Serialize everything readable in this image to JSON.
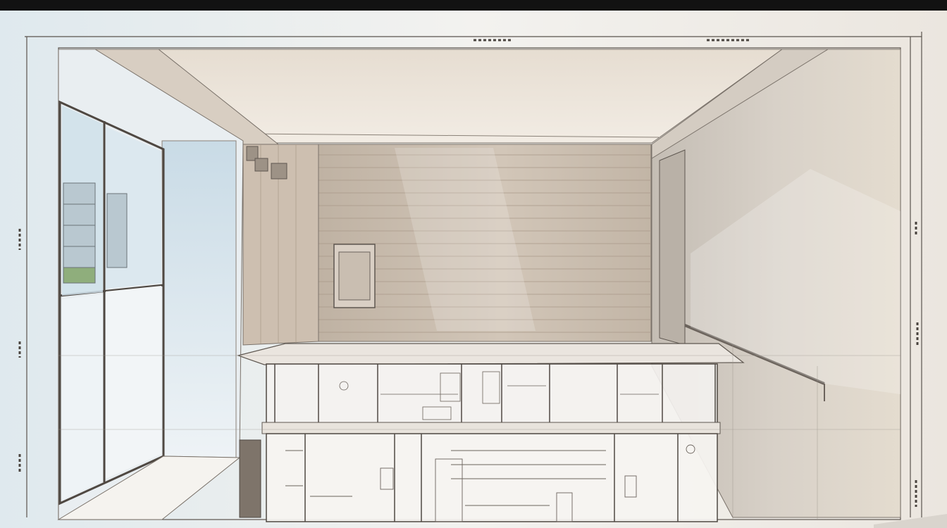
{
  "illustration": {
    "subject": "interior-perspective-sketch-with-window-and-plank-wall",
    "palette": {
      "frame_bar": "#121212",
      "paper": "#eef0f0",
      "ceiling": "#ece4da",
      "plank_wall": "#c9bcad",
      "right_wall": "#cfc7bd",
      "window_sky": "#dde9ef",
      "line": "#6b635c"
    }
  }
}
